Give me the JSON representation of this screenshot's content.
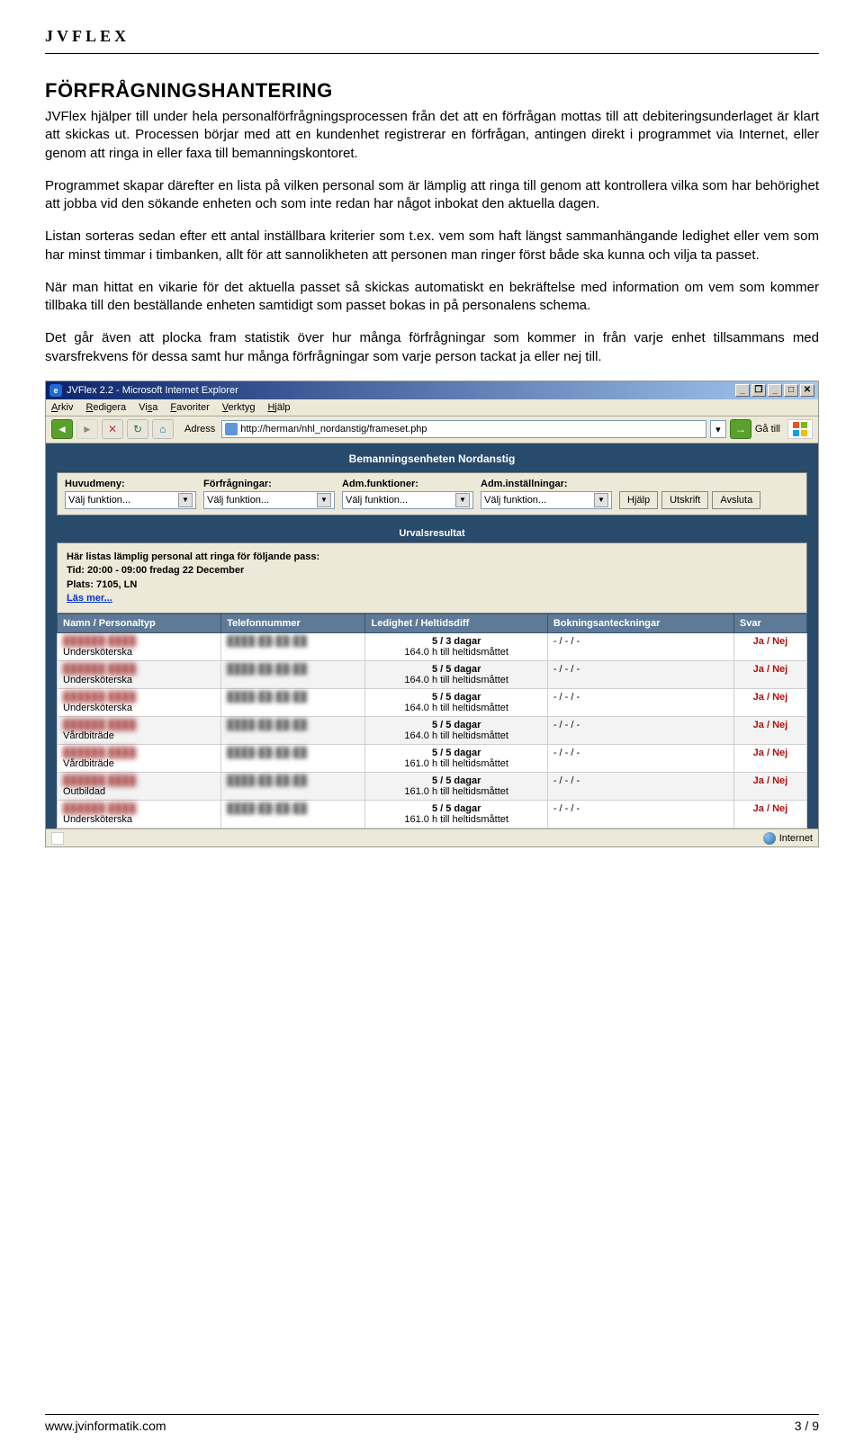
{
  "brand": "JVFLEX",
  "heading": "FÖRFRÅGNINGSHANTERING",
  "paragraphs": [
    "JVFlex hjälper till under hela personalförfrågningsprocessen från det att en förfrågan mottas till att debiteringsunderlaget är klart att skickas ut. Processen börjar med att en kundenhet registrerar en förfrågan, antingen direkt i programmet via Internet, eller genom att ringa in eller faxa till bemanningskontoret.",
    "Programmet skapar därefter en lista på vilken personal som är lämplig att ringa till genom att kontrollera vilka som har behörighet att jobba vid den sökande enheten och som inte redan har något inbokat den aktuella dagen.",
    "Listan sorteras sedan efter ett antal inställbara kriterier som t.ex. vem som haft längst sammanhängande ledighet eller vem som har minst timmar i timbanken, allt för att sannolikheten att personen man ringer först både ska kunna och vilja ta passet.",
    "När man hittat en vikarie för det aktuella passet så skickas automatiskt en bekräftelse med information om vem som kommer tillbaka till den beställande enheten samtidigt som passet bokas in på personalens schema.",
    "Det går även att plocka fram statistik över hur många förfrågningar som kommer in från varje enhet tillsammans med svarsfrekvens för dessa samt hur många förfrågningar som varje person tackat ja eller nej till."
  ],
  "browser": {
    "title": "JVFlex 2.2 - Microsoft Internet Explorer",
    "menu": [
      "Arkiv",
      "Redigera",
      "Visa",
      "Favoriter",
      "Verktyg",
      "Hjälp"
    ],
    "addressLabel": "Adress",
    "url": "http://herman/nhl_nordanstig/frameset.php",
    "go": "Gå till",
    "status": "Internet"
  },
  "app": {
    "title": "Bemanningsenheten Nordanstig",
    "dropdowns": [
      {
        "label": "Huvudmeny:",
        "value": "Välj funktion..."
      },
      {
        "label": "Förfrågningar:",
        "value": "Välj funktion..."
      },
      {
        "label": "Adm.funktioner:",
        "value": "Välj funktion..."
      },
      {
        "label": "Adm.inställningar:",
        "value": "Välj funktion..."
      }
    ],
    "buttons": [
      "Hjälp",
      "Utskrift",
      "Avsluta"
    ],
    "resultHeader": "Urvalsresultat",
    "infoLine1": "Här listas lämplig personal att ringa för följande pass:",
    "infoTid": "Tid: 20:00 - 09:00 fredag 22 December",
    "infoPlats": "Plats: 7105, LN",
    "infoLink": "Läs mer...",
    "columns": [
      "Namn / Personaltyp",
      "Telefonnummer",
      "Ledighet / Heltidsdiff",
      "Bokningsanteckningar",
      "Svar"
    ],
    "rows": [
      {
        "ptype": "Undersköterska",
        "days": "5 / 3 dagar",
        "hours": "164.0 h till heltidsmåttet",
        "notes": "- / - / -",
        "svar": "Ja / Nej"
      },
      {
        "ptype": "Undersköterska",
        "days": "5 / 5 dagar",
        "hours": "164.0 h till heltidsmåttet",
        "notes": "- / - / -",
        "svar": "Ja / Nej"
      },
      {
        "ptype": "Undersköterska",
        "days": "5 / 5 dagar",
        "hours": "164.0 h till heltidsmåttet",
        "notes": "- / - / -",
        "svar": "Ja / Nej"
      },
      {
        "ptype": "Vårdbiträde",
        "days": "5 / 5 dagar",
        "hours": "164.0 h till heltidsmåttet",
        "notes": "- / - / -",
        "svar": "Ja / Nej"
      },
      {
        "ptype": "Vårdbiträde",
        "days": "5 / 5 dagar",
        "hours": "161.0 h till heltidsmåttet",
        "notes": "- / - / -",
        "svar": "Ja / Nej"
      },
      {
        "ptype": "Outbildad",
        "days": "5 / 5 dagar",
        "hours": "161.0 h till heltidsmåttet",
        "notes": "- / - / -",
        "svar": "Ja / Nej"
      },
      {
        "ptype": "Undersköterska",
        "days": "5 / 5 dagar",
        "hours": "161.0 h till heltidsmåttet",
        "notes": "- / - / -",
        "svar": "Ja / Nej"
      }
    ]
  },
  "footer": {
    "site": "www.jvinformatik.com",
    "page": "3 / 9"
  }
}
